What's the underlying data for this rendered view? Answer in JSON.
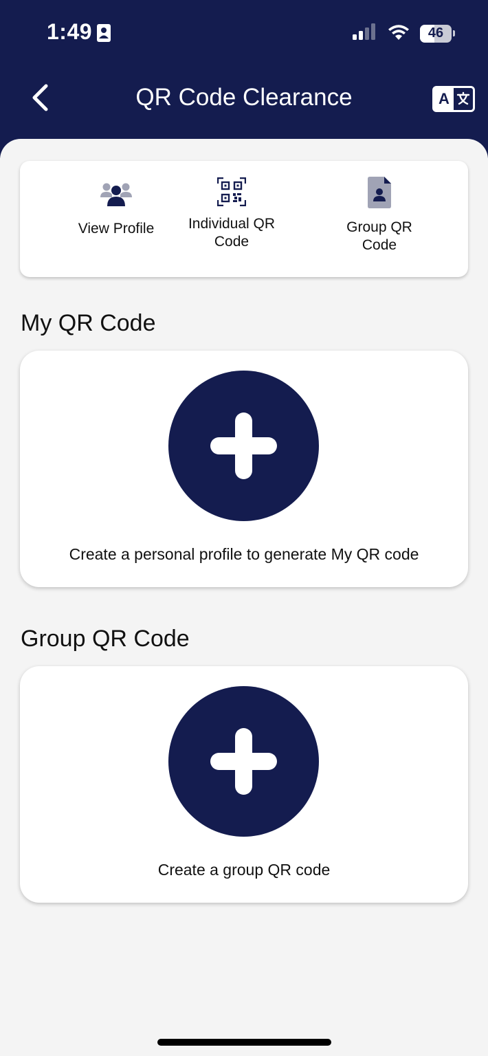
{
  "status_bar": {
    "time": "1:49",
    "battery_level": "46",
    "battery_fraction": 0.46
  },
  "nav": {
    "title": "QR Code Clearance",
    "back_icon": "chevron-left-icon",
    "translate_label": "A",
    "translate_icon": "translate-icon"
  },
  "shortcuts": [
    {
      "label": "View Profile",
      "icon": "users-icon"
    },
    {
      "label": "Individual QR Code",
      "icon": "qr-code-icon"
    },
    {
      "label": "Group QR Code",
      "icon": "document-user-icon"
    }
  ],
  "my_qr": {
    "title": "My QR Code",
    "caption": "Create a personal profile to generate My QR code",
    "icon": "plus-icon"
  },
  "group_qr": {
    "title": "Group QR Code",
    "caption": "Create a group QR code",
    "icon": "plus-icon"
  },
  "colors": {
    "brand_navy": "#141c4f",
    "icon_gray": "#a0a3b5",
    "background": "#f4f4f4",
    "card": "#ffffff"
  }
}
